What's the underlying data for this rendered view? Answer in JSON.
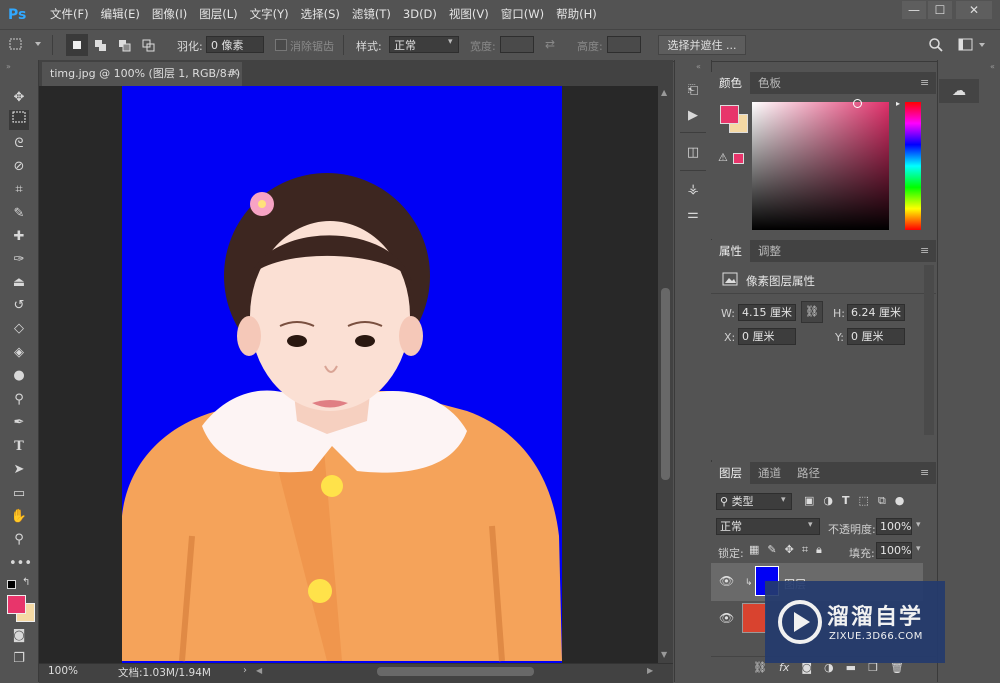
{
  "app": {
    "logo": "Ps"
  },
  "menu": [
    "文件(F)",
    "编辑(E)",
    "图像(I)",
    "图层(L)",
    "文字(Y)",
    "选择(S)",
    "滤镜(T)",
    "3D(D)",
    "视图(V)",
    "窗口(W)",
    "帮助(H)"
  ],
  "window_controls": {
    "minimize": "—",
    "maximize": "☐",
    "close": "✕"
  },
  "options": {
    "feather_label": "羽化:",
    "feather_value": "0 像素",
    "antialias_label": "消除锯齿",
    "style_label": "样式:",
    "style_value": "正常",
    "width_label": "宽度:",
    "height_label": "高度:",
    "select_mask_label": "选择并遮住 ..."
  },
  "document": {
    "tab_title": "timg.jpg @ 100% (图层 1, RGB/8#) *",
    "zoom": "100%",
    "doc_info": "文档:1.03M/1.94M"
  },
  "color_panel": {
    "tabs": [
      "颜色",
      "色板"
    ]
  },
  "properties_panel": {
    "tabs": [
      "属性",
      "调整"
    ],
    "title": "像素图层属性",
    "w_label": "W:",
    "w_value": "4.15 厘米",
    "h_label": "H:",
    "h_value": "6.24 厘米",
    "x_label": "X:",
    "x_value": "0 厘米",
    "y_label": "Y:",
    "y_value": "0 厘米"
  },
  "layers_panel": {
    "tabs": [
      "图层",
      "通道",
      "路径"
    ],
    "filter_kind": "类型",
    "blend_mode": "正常",
    "opacity_label": "不透明度:",
    "opacity_value": "100%",
    "lock_label": "锁定:",
    "fill_label": "填充:",
    "fill_value": "100%",
    "layers": [
      {
        "name": "图层"
      },
      {
        "name": ""
      }
    ]
  },
  "watermark": {
    "title": "溜溜自学",
    "url": "ZIXUE.3D66.COM"
  },
  "colors": {
    "foreground": "#e8356b",
    "background": "#f5d9a4",
    "canvas_bg": "#0000f5",
    "accent": "#31a8ff"
  }
}
